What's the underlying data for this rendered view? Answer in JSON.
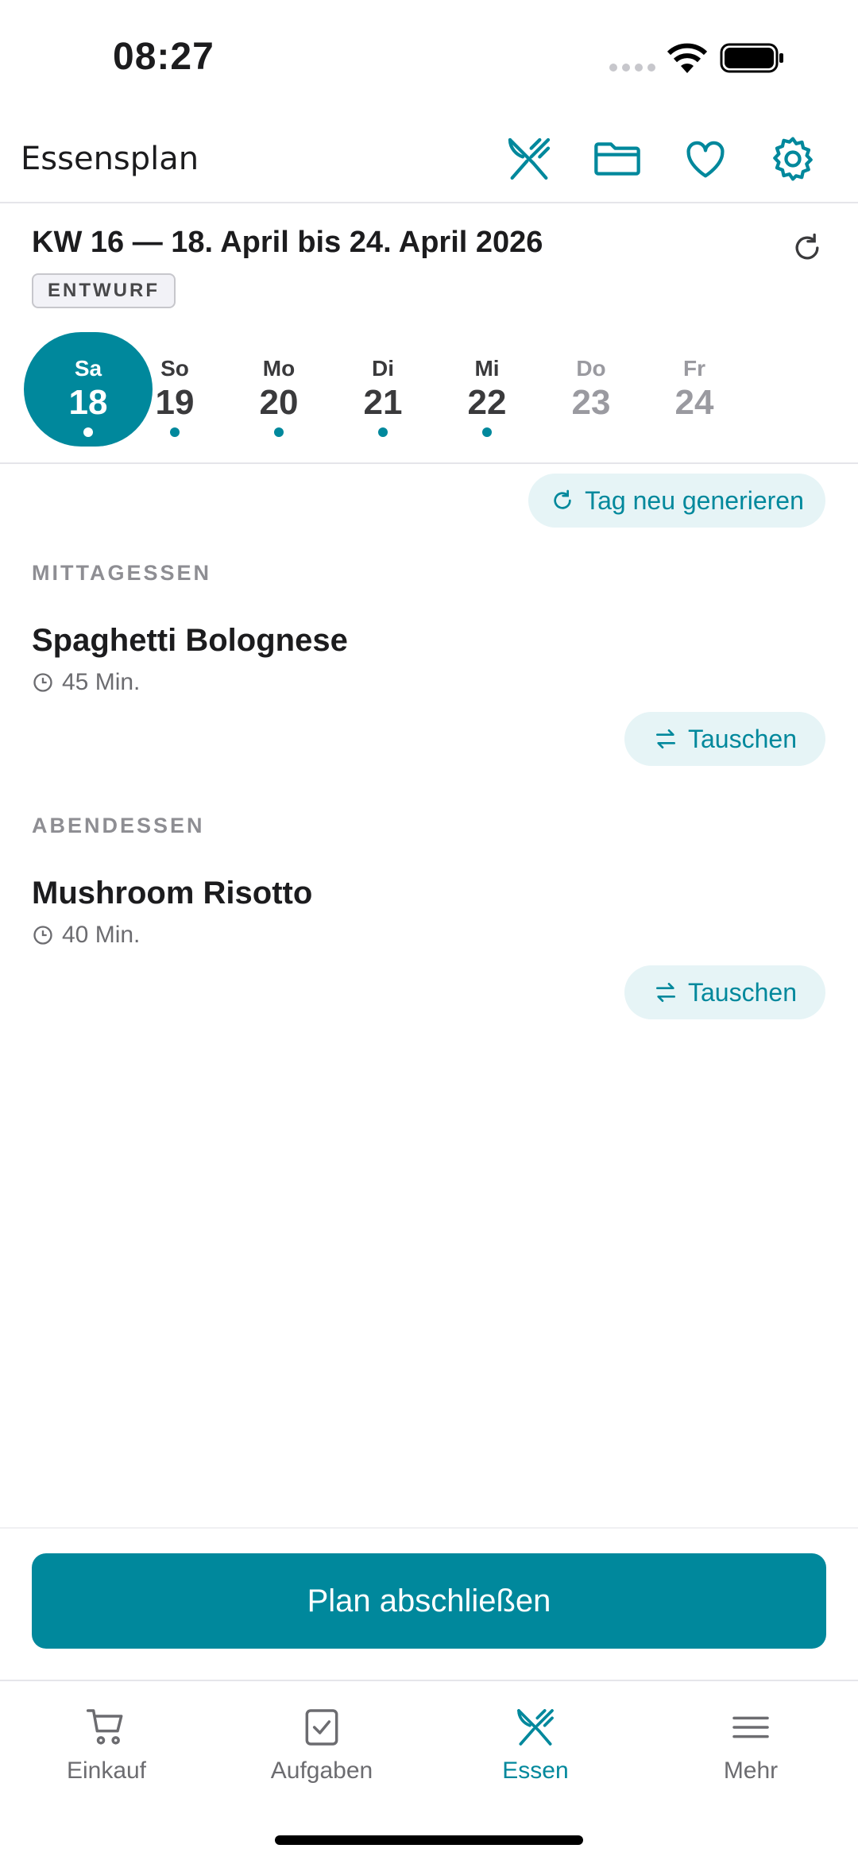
{
  "status_bar": {
    "time": "08:27"
  },
  "header": {
    "title": "Essensplan",
    "icons": [
      "utensils-icon",
      "folder-icon",
      "heart-icon",
      "gear-icon"
    ]
  },
  "week": {
    "title": "KW 16 — 18. April bis 24. April 2026",
    "badge": "ENTWURF"
  },
  "days": [
    {
      "name": "Sa",
      "num": "18",
      "state": "selected",
      "has_meals": true
    },
    {
      "name": "So",
      "num": "19",
      "state": "normal",
      "has_meals": true
    },
    {
      "name": "Mo",
      "num": "20",
      "state": "normal",
      "has_meals": true
    },
    {
      "name": "Di",
      "num": "21",
      "state": "normal",
      "has_meals": true
    },
    {
      "name": "Mi",
      "num": "22",
      "state": "normal",
      "has_meals": true
    },
    {
      "name": "Do",
      "num": "23",
      "state": "muted",
      "has_meals": false
    },
    {
      "name": "Fr",
      "num": "24",
      "state": "muted",
      "has_meals": false
    }
  ],
  "actions": {
    "regenerate_day": "Tag neu generieren"
  },
  "meals": [
    {
      "label": "MITTAGESSEN",
      "title": "Spaghetti Bolognese",
      "time": "45 Min.",
      "swap": "Tauschen"
    },
    {
      "label": "ABENDESSEN",
      "title": "Mushroom Risotto",
      "time": "40 Min.",
      "swap": "Tauschen"
    }
  ],
  "primary_action": "Plan abschließen",
  "tabs": [
    {
      "label": "Einkauf",
      "icon": "cart-icon",
      "active": false
    },
    {
      "label": "Aufgaben",
      "icon": "checkbox-icon",
      "active": false
    },
    {
      "label": "Essen",
      "icon": "utensils-icon",
      "active": true
    },
    {
      "label": "Mehr",
      "icon": "menu-icon",
      "active": false
    }
  ],
  "colors": {
    "accent": "#00889c",
    "accent_light": "#e6f4f6"
  }
}
